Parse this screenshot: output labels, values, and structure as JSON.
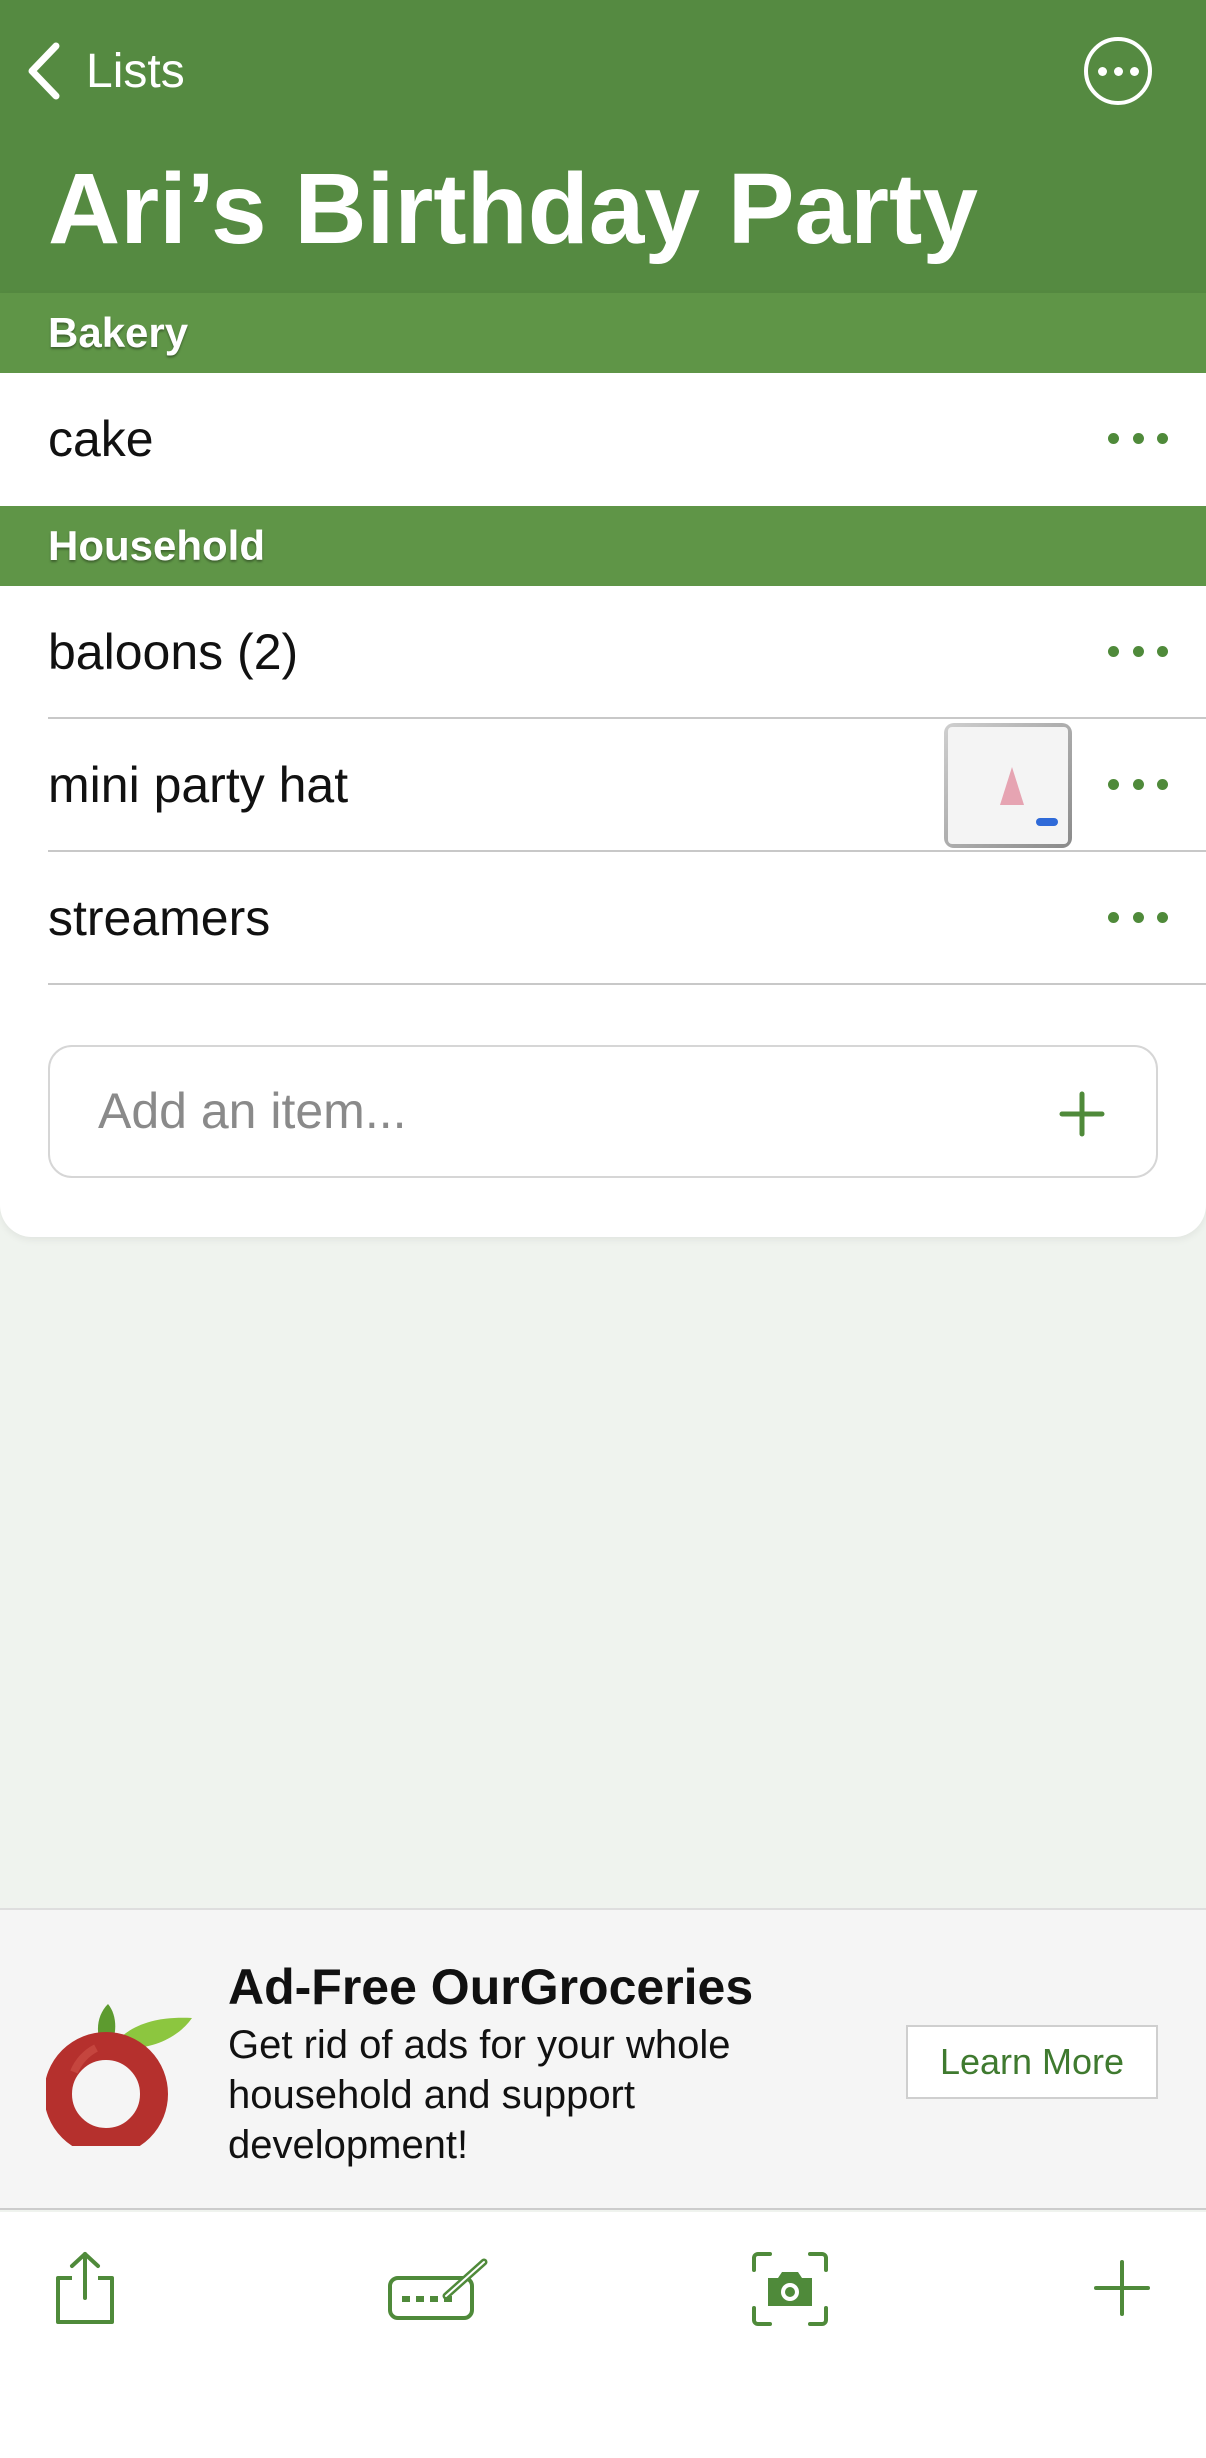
{
  "header": {
    "back_label": "Lists",
    "title": "Ari’s Birthday Party",
    "back_icon": "chevron-left-icon",
    "more_icon": "ellipsis-circle-icon"
  },
  "sections": [
    {
      "name": "Bakery",
      "items": [
        {
          "name": "cake"
        }
      ]
    },
    {
      "name": "Household",
      "items": [
        {
          "name": "baloons (2)"
        },
        {
          "name": "mini party hat",
          "has_photo": true
        },
        {
          "name": "streamers"
        }
      ]
    }
  ],
  "add_item": {
    "placeholder": "Add an item..."
  },
  "ad": {
    "title": "Ad-Free OurGroceries",
    "description": "Get rid of ads for your whole household and support development!",
    "button_label": "Learn More"
  },
  "toolbar": {
    "icons": [
      "share-icon",
      "keyboard-pencil-icon",
      "camera-icon",
      "plus-icon"
    ]
  },
  "colors": {
    "header_bg": "#558a41",
    "section_bg": "#5f9547",
    "accent": "#4f8a3a",
    "page_bg": "#eff3ee"
  }
}
